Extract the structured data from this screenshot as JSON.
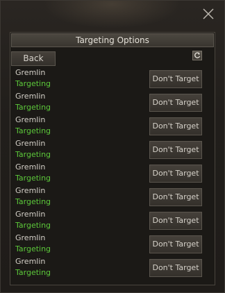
{
  "header": {
    "title": "Targeting Options"
  },
  "toolbar": {
    "back_label": "Back"
  },
  "icons": {
    "close": "close-icon",
    "refresh": "refresh-icon"
  },
  "colors": {
    "status_targeting": "#5cc83a"
  },
  "rows": [
    {
      "name": "Gremlin",
      "status": "Targeting",
      "action": "Don't Target"
    },
    {
      "name": "Gremlin",
      "status": "Targeting",
      "action": "Don't Target"
    },
    {
      "name": "Gremlin",
      "status": "Targeting",
      "action": "Don't Target"
    },
    {
      "name": "Gremlin",
      "status": "Targeting",
      "action": "Don't Target"
    },
    {
      "name": "Gremlin",
      "status": "Targeting",
      "action": "Don't Target"
    },
    {
      "name": "Gremlin",
      "status": "Targeting",
      "action": "Don't Target"
    },
    {
      "name": "Gremlin",
      "status": "Targeting",
      "action": "Don't Target"
    },
    {
      "name": "Gremlin",
      "status": "Targeting",
      "action": "Don't Target"
    },
    {
      "name": "Gremlin",
      "status": "Targeting",
      "action": "Don't Target"
    }
  ]
}
